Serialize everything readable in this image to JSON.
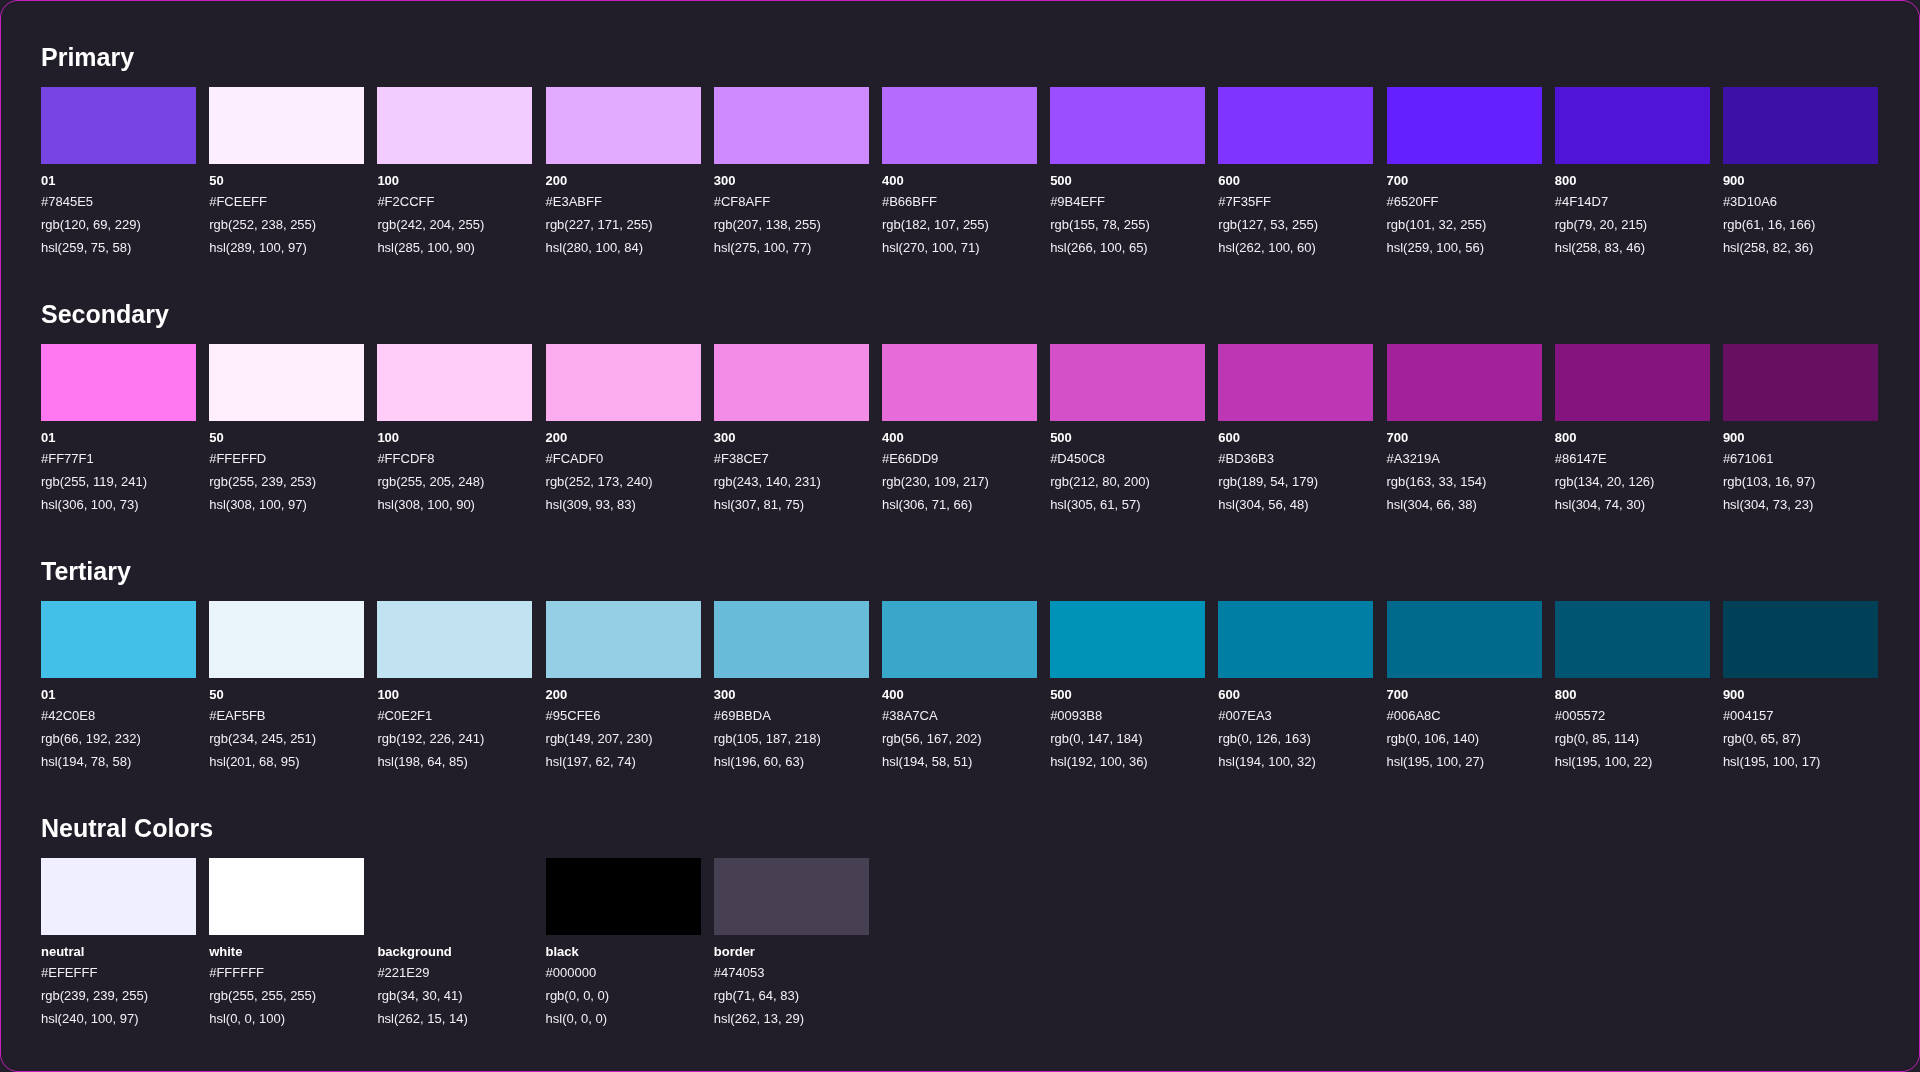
{
  "sections": [
    {
      "title": "Primary",
      "swatches": [
        {
          "name": "01",
          "color": "#7845e5",
          "hex": "#7845E5",
          "rgb": "rgb(120, 69, 229)",
          "hsl": "hsl(259, 75, 58)"
        },
        {
          "name": "50",
          "color": "#fceeff",
          "hex": "#FCEEFF",
          "rgb": "rgb(252, 238, 255)",
          "hsl": "hsl(289, 100, 97)"
        },
        {
          "name": "100",
          "color": "#f2ccff",
          "hex": "#F2CCFF",
          "rgb": "rgb(242, 204, 255)",
          "hsl": "hsl(285, 100, 90)"
        },
        {
          "name": "200",
          "color": "#e3abff",
          "hex": "#E3ABFF",
          "rgb": "rgb(227, 171, 255)",
          "hsl": "hsl(280, 100, 84)"
        },
        {
          "name": "300",
          "color": "#cf8aff",
          "hex": "#CF8AFF",
          "rgb": "rgb(207, 138, 255)",
          "hsl": "hsl(275, 100, 77)"
        },
        {
          "name": "400",
          "color": "#b66bff",
          "hex": "#B66BFF",
          "rgb": "rgb(182, 107, 255)",
          "hsl": "hsl(270, 100, 71)"
        },
        {
          "name": "500",
          "color": "#9b4eff",
          "hex": "#9B4EFF",
          "rgb": "rgb(155, 78, 255)",
          "hsl": "hsl(266, 100, 65)"
        },
        {
          "name": "600",
          "color": "#7f35ff",
          "hex": "#7F35FF",
          "rgb": "rgb(127, 53, 255)",
          "hsl": "hsl(262, 100, 60)"
        },
        {
          "name": "700",
          "color": "#6520ff",
          "hex": "#6520FF",
          "rgb": "rgb(101, 32, 255)",
          "hsl": "hsl(259, 100, 56)"
        },
        {
          "name": "800",
          "color": "#4f14d7",
          "hex": "#4F14D7",
          "rgb": "rgb(79, 20, 215)",
          "hsl": "hsl(258, 83, 46)"
        },
        {
          "name": "900",
          "color": "#3d10a6",
          "hex": "#3D10A6",
          "rgb": "rgb(61, 16, 166)",
          "hsl": "hsl(258, 82, 36)"
        }
      ]
    },
    {
      "title": "Secondary",
      "swatches": [
        {
          "name": "01",
          "color": "#ff77f1",
          "hex": "#FF77F1",
          "rgb": "rgb(255, 119, 241)",
          "hsl": "hsl(306, 100, 73)"
        },
        {
          "name": "50",
          "color": "#ffeffd",
          "hex": "#FFEFFD",
          "rgb": "rgb(255, 239, 253)",
          "hsl": "hsl(308, 100, 97)"
        },
        {
          "name": "100",
          "color": "#ffcdf8",
          "hex": "#FFCDF8",
          "rgb": "rgb(255, 205, 248)",
          "hsl": "hsl(308, 100, 90)"
        },
        {
          "name": "200",
          "color": "#fcadf0",
          "hex": "#FCADF0",
          "rgb": "rgb(252, 173, 240)",
          "hsl": "hsl(309, 93, 83)"
        },
        {
          "name": "300",
          "color": "#f38ce7",
          "hex": "#F38CE7",
          "rgb": "rgb(243, 140, 231)",
          "hsl": "hsl(307, 81, 75)"
        },
        {
          "name": "400",
          "color": "#e66dd9",
          "hex": "#E66DD9",
          "rgb": "rgb(230, 109, 217)",
          "hsl": "hsl(306, 71, 66)"
        },
        {
          "name": "500",
          "color": "#d450c8",
          "hex": "#D450C8",
          "rgb": "rgb(212, 80, 200)",
          "hsl": "hsl(305, 61, 57)"
        },
        {
          "name": "600",
          "color": "#bd36b3",
          "hex": "#BD36B3",
          "rgb": "rgb(189, 54, 179)",
          "hsl": "hsl(304, 56, 48)"
        },
        {
          "name": "700",
          "color": "#a3219a",
          "hex": "#A3219A",
          "rgb": "rgb(163, 33, 154)",
          "hsl": "hsl(304, 66, 38)"
        },
        {
          "name": "800",
          "color": "#86147e",
          "hex": "#86147E",
          "rgb": "rgb(134, 20, 126)",
          "hsl": "hsl(304, 74, 30)"
        },
        {
          "name": "900",
          "color": "#671061",
          "hex": "#671061",
          "rgb": "rgb(103, 16, 97)",
          "hsl": "hsl(304, 73, 23)"
        }
      ]
    },
    {
      "title": "Tertiary",
      "swatches": [
        {
          "name": "01",
          "color": "#42c0e8",
          "hex": "#42C0E8",
          "rgb": "rgb(66, 192, 232)",
          "hsl": "hsl(194, 78, 58)"
        },
        {
          "name": "50",
          "color": "#eaf5fb",
          "hex": "#EAF5FB",
          "rgb": "rgb(234, 245, 251)",
          "hsl": "hsl(201, 68, 95)"
        },
        {
          "name": "100",
          "color": "#c0e2f1",
          "hex": "#C0E2F1",
          "rgb": "rgb(192, 226, 241)",
          "hsl": "hsl(198, 64, 85)"
        },
        {
          "name": "200",
          "color": "#95cfe6",
          "hex": "#95CFE6",
          "rgb": "rgb(149, 207, 230)",
          "hsl": "hsl(197, 62, 74)"
        },
        {
          "name": "300",
          "color": "#69bbda",
          "hex": "#69BBDA",
          "rgb": "rgb(105, 187, 218)",
          "hsl": "hsl(196, 60, 63)"
        },
        {
          "name": "400",
          "color": "#38a7ca",
          "hex": "#38A7CA",
          "rgb": "rgb(56, 167, 202)",
          "hsl": "hsl(194, 58, 51)"
        },
        {
          "name": "500",
          "color": "#0093b8",
          "hex": "#0093B8",
          "rgb": "rgb(0, 147, 184)",
          "hsl": "hsl(192, 100, 36)"
        },
        {
          "name": "600",
          "color": "#007ea3",
          "hex": "#007EA3",
          "rgb": "rgb(0, 126, 163)",
          "hsl": "hsl(194, 100, 32)"
        },
        {
          "name": "700",
          "color": "#006a8c",
          "hex": "#006A8C",
          "rgb": "rgb(0, 106, 140)",
          "hsl": "hsl(195, 100, 27)"
        },
        {
          "name": "800",
          "color": "#005572",
          "hex": "#005572",
          "rgb": "rgb(0, 85, 114)",
          "hsl": "hsl(195, 100, 22)"
        },
        {
          "name": "900",
          "color": "#004157",
          "hex": "#004157",
          "rgb": "rgb(0, 65, 87)",
          "hsl": "hsl(195, 100, 17)"
        }
      ]
    },
    {
      "title": "Neutral Colors",
      "swatches": [
        {
          "name": "neutral",
          "color": "#efefff",
          "hex": "#EFEFFF",
          "rgb": "rgb(239, 239, 255)",
          "hsl": "hsl(240, 100, 97)"
        },
        {
          "name": "white",
          "color": "#ffffff",
          "hex": "#FFFFFF",
          "rgb": "rgb(255, 255, 255)",
          "hsl": "hsl(0, 0, 100)"
        },
        {
          "name": "background",
          "hex": "#221E29",
          "rgb": "rgb(34, 30, 41)",
          "hsl": "hsl(262, 15, 14)"
        },
        {
          "name": "black",
          "color": "#000000",
          "hex": "#000000",
          "rgb": "rgb(0, 0, 0)",
          "hsl": "hsl(0, 0, 0)"
        },
        {
          "name": "border",
          "color": "#474053",
          "hex": "#474053",
          "rgb": "rgb(71, 64, 83)",
          "hsl": "hsl(262, 13, 29)"
        }
      ]
    }
  ]
}
